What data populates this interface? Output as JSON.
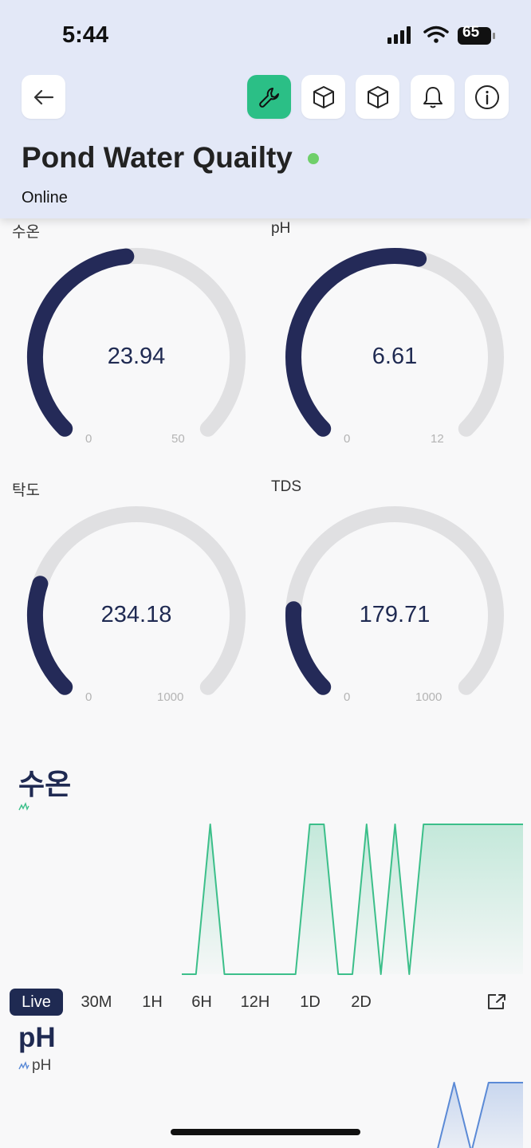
{
  "status_bar": {
    "time": "5:44",
    "battery": "65"
  },
  "header": {
    "title": "Pond Water Quailty",
    "status": "Online",
    "buttons": [
      "back-arrow-icon",
      "wrench-icon",
      "cube-icon",
      "cube-icon",
      "bell-icon",
      "info-icon"
    ],
    "accent_color": "#2bbf86",
    "online_color": "#6fcf6a"
  },
  "gauges": [
    {
      "label": "수온",
      "value": "23.94",
      "min": "0",
      "max": "50",
      "fraction": 0.4788
    },
    {
      "label": "pH",
      "value": "6.61",
      "min": "0",
      "max": "12",
      "fraction": 0.5508
    },
    {
      "label": "탁도",
      "value": "234.18",
      "min": "0",
      "max": "1000",
      "fraction": 0.2342
    },
    {
      "label": "TDS",
      "value": "179.71",
      "min": "0",
      "max": "1000",
      "fraction": 0.1797
    }
  ],
  "gauge_colors": {
    "fill": "#242a58",
    "track": "#e0e0e2"
  },
  "chart_section": {
    "title": "수온",
    "tabs": [
      "Live",
      "30M",
      "1H",
      "6H",
      "12H",
      "1D",
      "2D"
    ],
    "active_tab": "Live"
  },
  "ph_section": {
    "title": "pH",
    "legend": "pH"
  },
  "chart_data": [
    {
      "type": "area",
      "title": "수온",
      "x": [
        0,
        1,
        2,
        3,
        4,
        5,
        6,
        7,
        8,
        9,
        10,
        11,
        12,
        13,
        14,
        15,
        16,
        17,
        18,
        19,
        20,
        21,
        22,
        23,
        24
      ],
      "series": [
        {
          "values": [
            0,
            0,
            1,
            0,
            0,
            0,
            0,
            0,
            0,
            1,
            1,
            0,
            0,
            1,
            0,
            1,
            0,
            1,
            1,
            1,
            1,
            1,
            1,
            1,
            1
          ]
        }
      ],
      "color": "#3cbf8a"
    },
    {
      "type": "area",
      "title": "pH",
      "series": [
        {
          "name": "pH",
          "values": [
            0,
            1,
            0,
            1,
            1,
            1
          ]
        }
      ],
      "color": "#5b8ad6"
    }
  ]
}
